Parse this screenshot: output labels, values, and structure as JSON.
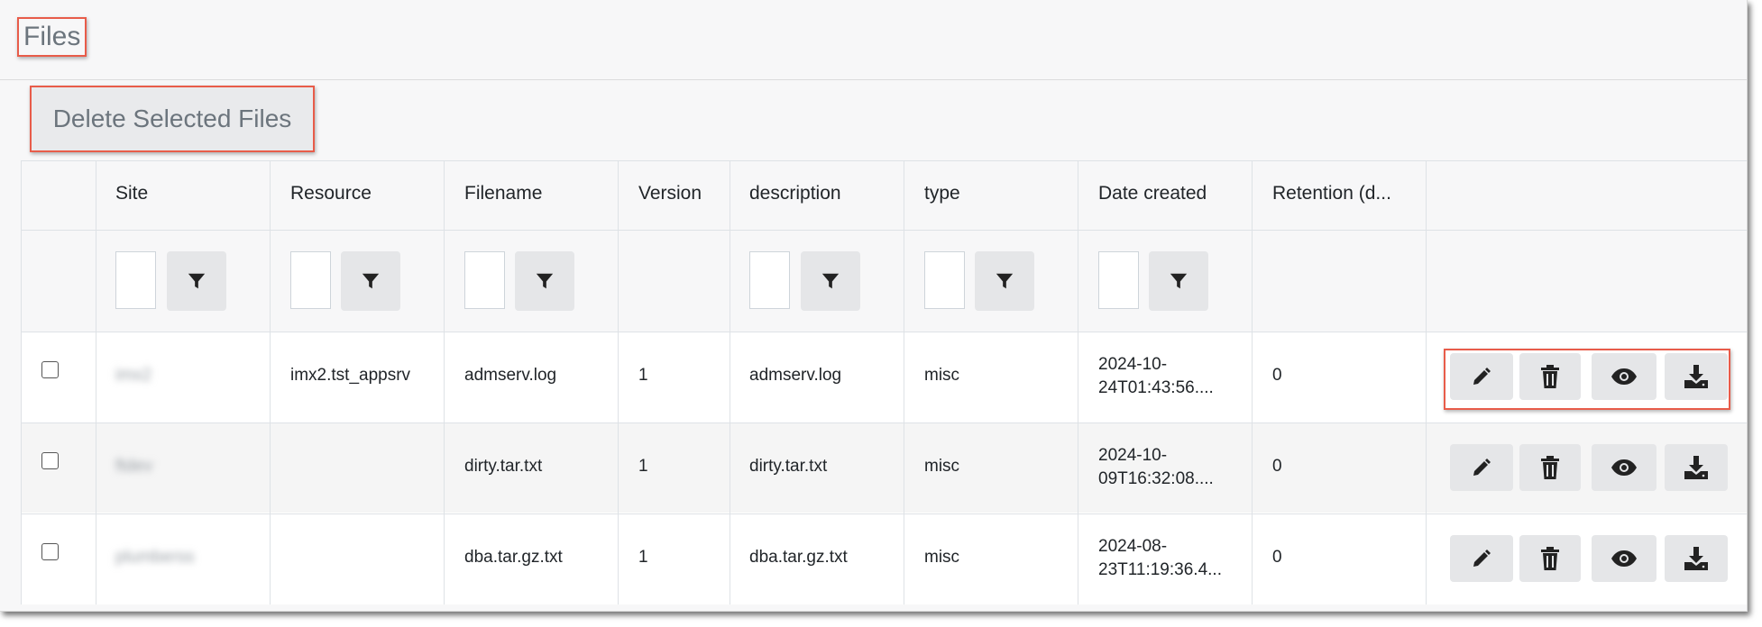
{
  "page": {
    "title": "Files"
  },
  "toolbar": {
    "delete_label": "Delete Selected Files"
  },
  "table": {
    "columns": [
      {
        "key": "site",
        "label": "Site",
        "filterable": true
      },
      {
        "key": "resource",
        "label": "Resource",
        "filterable": true
      },
      {
        "key": "filename",
        "label": "Filename",
        "filterable": true
      },
      {
        "key": "version",
        "label": "Version",
        "filterable": false
      },
      {
        "key": "description",
        "label": "description",
        "filterable": true
      },
      {
        "key": "type",
        "label": "type",
        "filterable": true
      },
      {
        "key": "date_created",
        "label": "Date created",
        "filterable": true
      },
      {
        "key": "retention",
        "label": "Retention (d...",
        "filterable": false
      }
    ],
    "rows": [
      {
        "site": "imx2",
        "resource": "imx2.tst_appsrv",
        "filename": "admserv.log",
        "version": "1",
        "description": "admserv.log",
        "type": "misc",
        "date_line1": "2024-10-",
        "date_line2": "24T01:43:56....",
        "retention": "0",
        "checked": false
      },
      {
        "site": "ftdev",
        "resource": "",
        "filename": "dirty.tar.txt",
        "version": "1",
        "description": "dirty.tar.txt",
        "type": "misc",
        "date_line1": "2024-10-",
        "date_line2": "09T16:32:08....",
        "retention": "0",
        "checked": false
      },
      {
        "site": "plumberss",
        "resource": "",
        "filename": "dba.tar.gz.txt",
        "version": "1",
        "description": "dba.tar.gz.txt",
        "type": "misc",
        "date_line1": "2024-08-",
        "date_line2": "23T11:19:36.4...",
        "retention": "0",
        "checked": false
      }
    ],
    "row_actions": [
      "pencil-icon",
      "trash-icon",
      "eye-icon",
      "download-icon"
    ]
  },
  "colors": {
    "highlight": "#e85c4a",
    "button_bg": "#e5e6e8",
    "text_muted": "#6c757d"
  }
}
